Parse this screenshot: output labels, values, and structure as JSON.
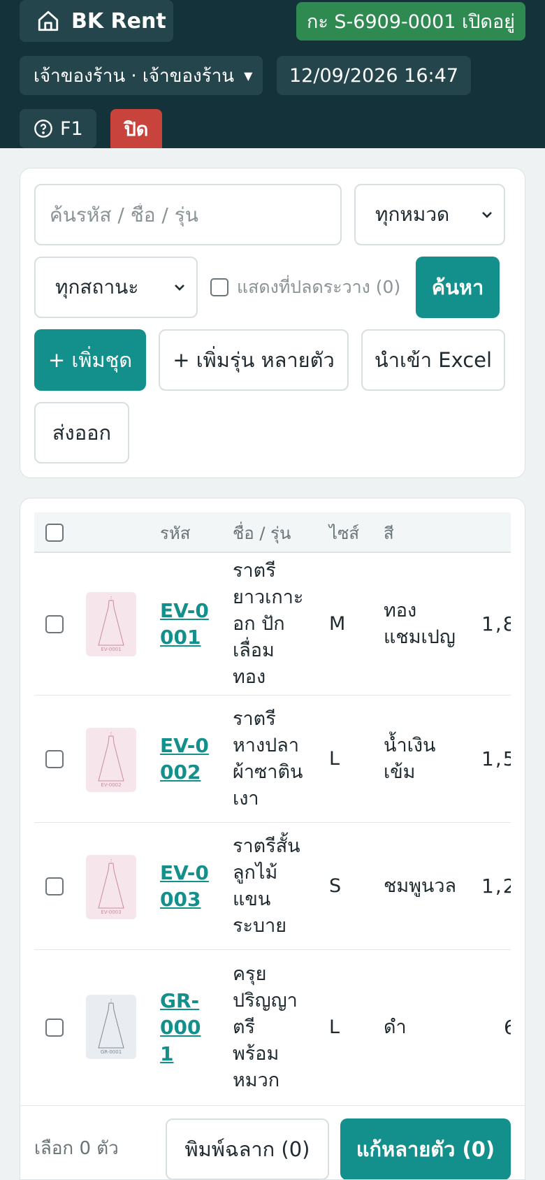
{
  "header": {
    "brand": "BK Rent",
    "shift_badge": "กะ S-6909-0001 เปิดอยู่",
    "user_label": "เจ้าของร้าน · เจ้าของร้าน",
    "datetime": "12/09/2026 16:47",
    "help_label": "F1",
    "close_label": "ปิด"
  },
  "filters": {
    "search_placeholder": "ค้นรหัส / ชื่อ / รุ่น",
    "category_selected": "ทุกหมวด",
    "status_selected": "ทุกสถานะ",
    "show_discontinued_label": "แสดงที่ปลดระวาง (0)",
    "search_button": "ค้นหา",
    "add_set_button": "+ เพิ่มชุด",
    "add_multi_button": "+ เพิ่มรุ่น หลายตัว",
    "import_excel_button": "นำเข้า Excel",
    "export_button": "ส่งออก"
  },
  "table": {
    "columns": [
      "รหัส",
      "ชื่อ / รุ่น",
      "ไซส์",
      "สี"
    ],
    "rows": [
      {
        "code": "EV-0001",
        "name": "ราตรียาวเกาะอก ปักเลื่อมทอง",
        "size": "M",
        "color": "ทองแชมเปญ",
        "price_partial": "1,8",
        "thumb_label": "EV-0001"
      },
      {
        "code": "EV-0002",
        "name": "ราตรีหางปลา ผ้าซาตินเงา",
        "size": "L",
        "color": "น้ำเงินเข้ม",
        "price_partial": "1,5",
        "thumb_label": "EV-0002"
      },
      {
        "code": "EV-0003",
        "name": "ราตรีสั้นลูกไม้ แขนระบาย",
        "size": "S",
        "color": "ชมพูนวล",
        "price_partial": "1,2",
        "thumb_label": "EV-0003"
      },
      {
        "code": "GR-0001",
        "name": "ครุยปริญญาตรี พร้อมหมวก",
        "size": "L",
        "color": "ดำ",
        "price_partial": "6",
        "thumb_label": "GR-0001"
      }
    ]
  },
  "footer": {
    "selected_count": "เลือก 0 ตัว",
    "print_labels_button": "พิมพ์ฉลาก (0)",
    "bulk_edit_button": "แก้หลายตัว (0)"
  },
  "colors": {
    "header_bg": "#143239",
    "accent": "#138f8c",
    "shift_badge": "#2f8a52",
    "danger": "#c8433b"
  }
}
